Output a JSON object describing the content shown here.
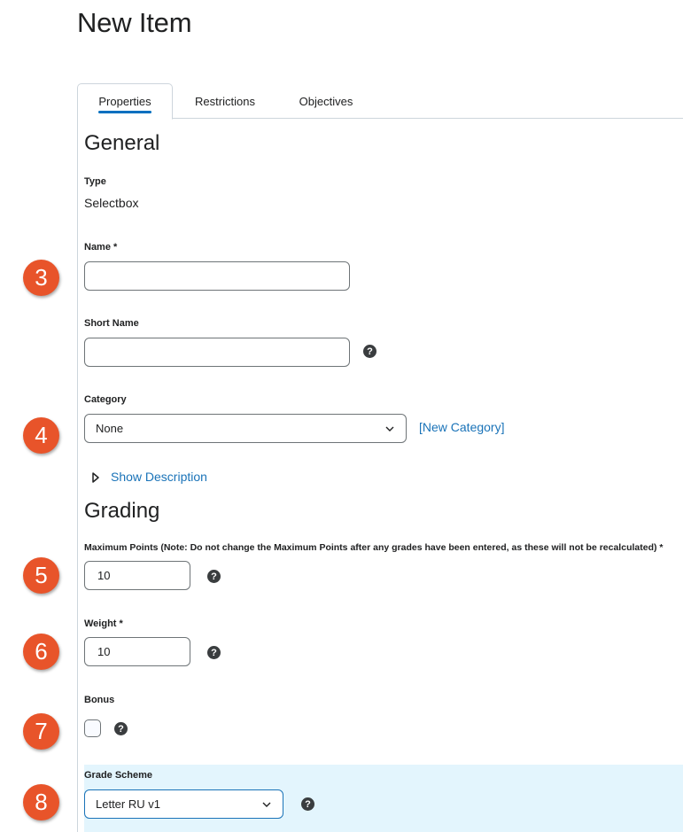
{
  "page": {
    "title": "New Item"
  },
  "tabs": [
    {
      "label": "Properties",
      "active": true
    },
    {
      "label": "Restrictions",
      "active": false
    },
    {
      "label": "Objectives",
      "active": false
    }
  ],
  "general": {
    "heading": "General",
    "type_label": "Type",
    "type_value": "Selectbox",
    "name_label": "Name *",
    "name_value": "",
    "short_name_label": "Short Name",
    "short_name_value": "",
    "category_label": "Category",
    "category_selected": "None",
    "new_category_link": "[New Category]",
    "show_description": "Show Description"
  },
  "grading": {
    "heading": "Grading",
    "max_points_label": "Maximum Points (Note: Do not change the Maximum Points after any grades have been entered, as these will not be recalculated) *",
    "max_points_value": "10",
    "weight_label": "Weight *",
    "weight_value": "10",
    "bonus_label": "Bonus",
    "bonus_checked": false,
    "grade_scheme_label": "Grade Scheme",
    "grade_scheme_selected": "Letter RU v1"
  },
  "callouts": [
    "3",
    "4",
    "5",
    "6",
    "7",
    "8"
  ],
  "help_icon_glyph": "?",
  "colors": {
    "accent": "#006fbf",
    "link": "#1a73b8",
    "callout": "#e8542a",
    "highlight": "#e3f5fd"
  }
}
